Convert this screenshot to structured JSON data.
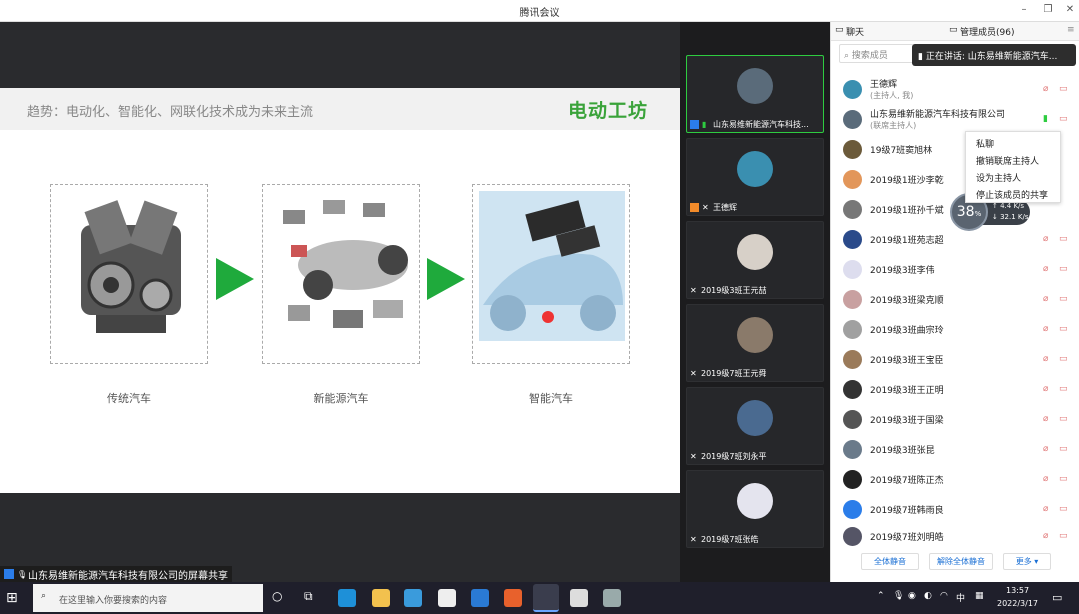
{
  "window": {
    "title": "腾讯会议"
  },
  "slide": {
    "headline": "趋势：电动化、智能化、网联化技术成为未来主流",
    "logo": "电动工坊",
    "captions": [
      "传统汽车",
      "新能源汽车",
      "智能汽车"
    ]
  },
  "share_label": "山东易维新能源汽车科技有限公司的屏幕共享",
  "video_tiles": [
    {
      "name": "山东易维新能源汽车科技..."
    },
    {
      "name": "王德辉"
    },
    {
      "name": "2019级3班王元喆"
    },
    {
      "name": "2019级7班王元舜"
    },
    {
      "name": "2019级7班刘永平"
    },
    {
      "name": "2019级7班张皓"
    }
  ],
  "panel": {
    "tab_chat": "聊天",
    "tab_members": "管理成员(96)",
    "search_placeholder": "搜索成员",
    "speaking": "正在讲话: 山东易维新能源汽车...",
    "members": [
      {
        "name": "王德辉",
        "sub": "(主持人, 我)"
      },
      {
        "name": "山东易维新能源汽车科技有限公司",
        "sub": "(联席主持人)"
      },
      {
        "name": "19级7班窦旭林"
      },
      {
        "name": "2019级1班沙李乾"
      },
      {
        "name": "2019级1班孙千斌"
      },
      {
        "name": "2019级1班苑志超"
      },
      {
        "name": "2019级3班李伟"
      },
      {
        "name": "2019级3班梁克顺"
      },
      {
        "name": "2019级3班曲宗玲"
      },
      {
        "name": "2019级3班王宝臣"
      },
      {
        "name": "2019级3班王正明"
      },
      {
        "name": "2019级3班于国梁"
      },
      {
        "name": "2019级3班张昆"
      },
      {
        "name": "2019级7班陈正杰"
      },
      {
        "name": "2019级7班韩雨良"
      },
      {
        "name": "2019级7班刘明皓"
      }
    ],
    "context_menu": [
      "私聊",
      "撤销联席主持人",
      "设为主持人",
      "停止该成员的共享"
    ],
    "net": {
      "percent": "38",
      "unit": "%",
      "up": "4.4",
      "down": "32.1",
      "rate_unit": "K/s"
    },
    "buttons": {
      "mute_all": "全体静音",
      "unmute_all": "解除全体静音",
      "more": "更多 ▾"
    }
  },
  "taskbar": {
    "search_placeholder": "在这里输入你要搜索的内容",
    "time": "13:57",
    "date": "2022/3/17",
    "ime": "中"
  },
  "colors": {
    "accent_green": "#1faa3c",
    "link_blue": "#1a6fd4",
    "mute_red": "#e07575"
  }
}
